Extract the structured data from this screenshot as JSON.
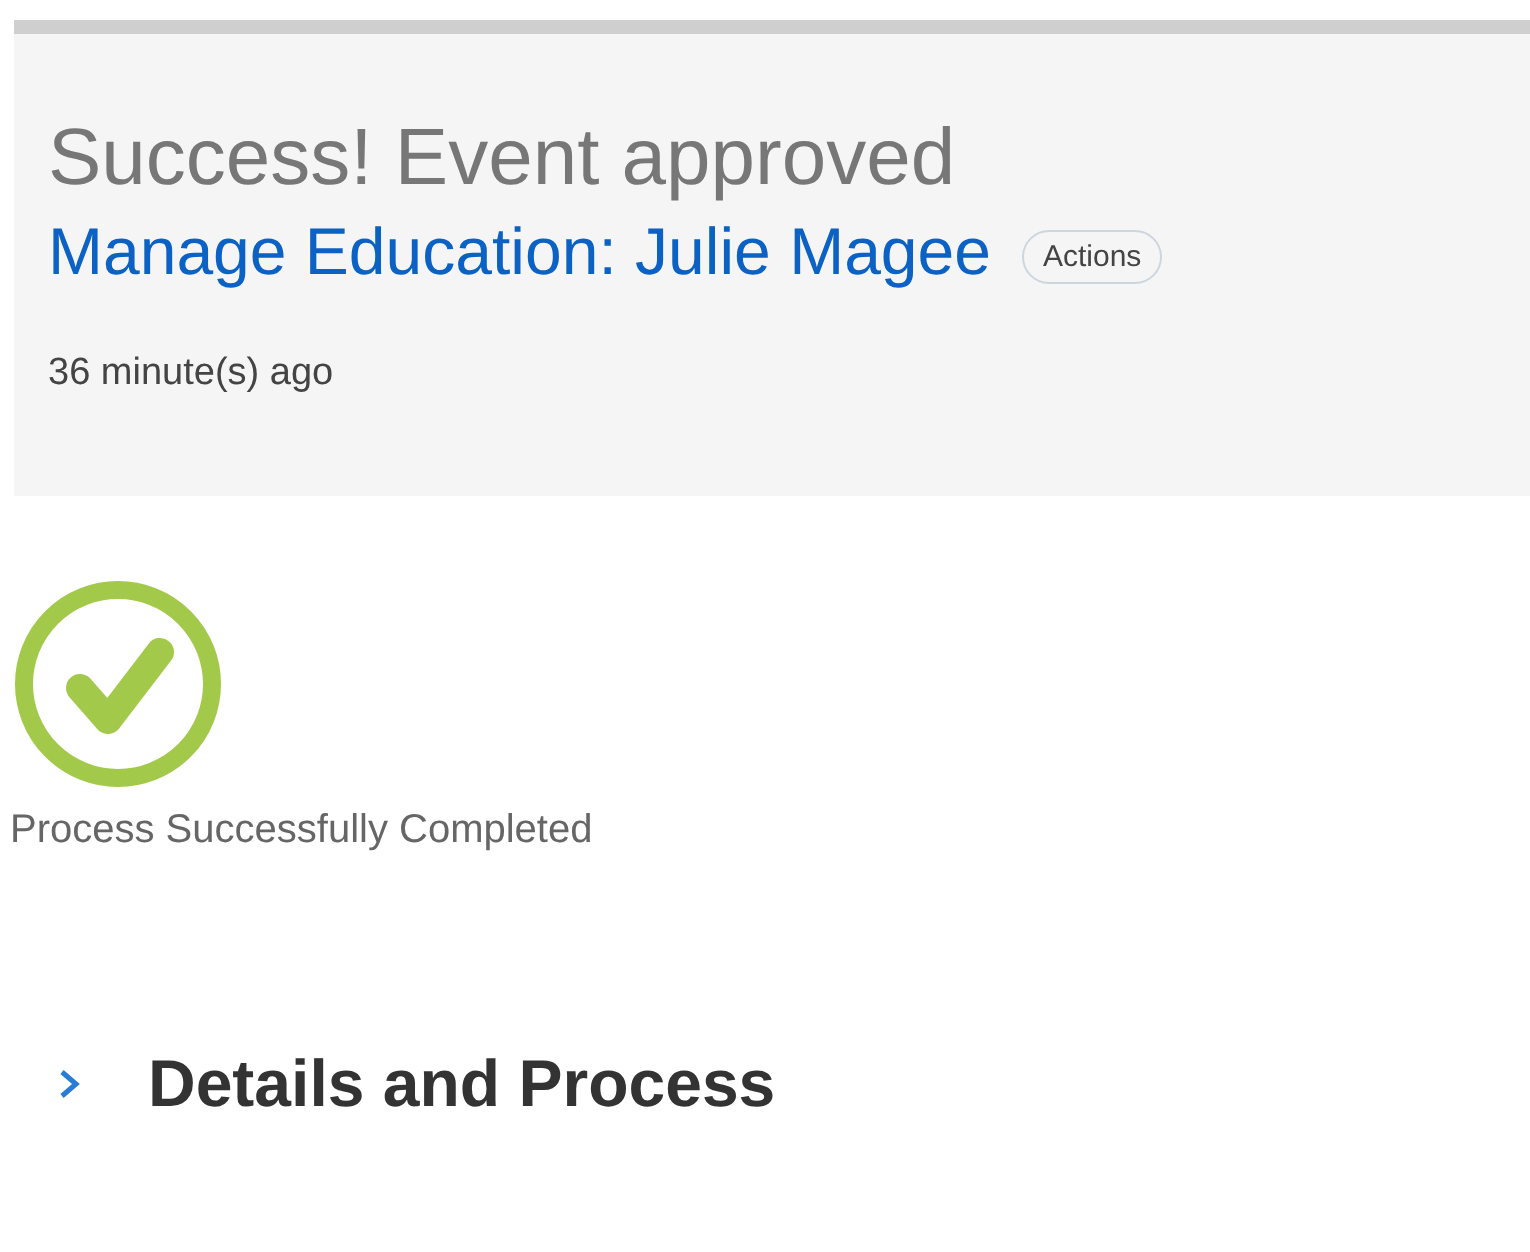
{
  "header": {
    "title": "Success! Event approved",
    "link": "Manage Education: Julie Magee",
    "actions_button": "Actions",
    "time": "36 minute(s) ago"
  },
  "status": {
    "kind": "success",
    "text": "Process Successfully Completed"
  },
  "section": {
    "title": "Details and Process",
    "expanded": false
  }
}
